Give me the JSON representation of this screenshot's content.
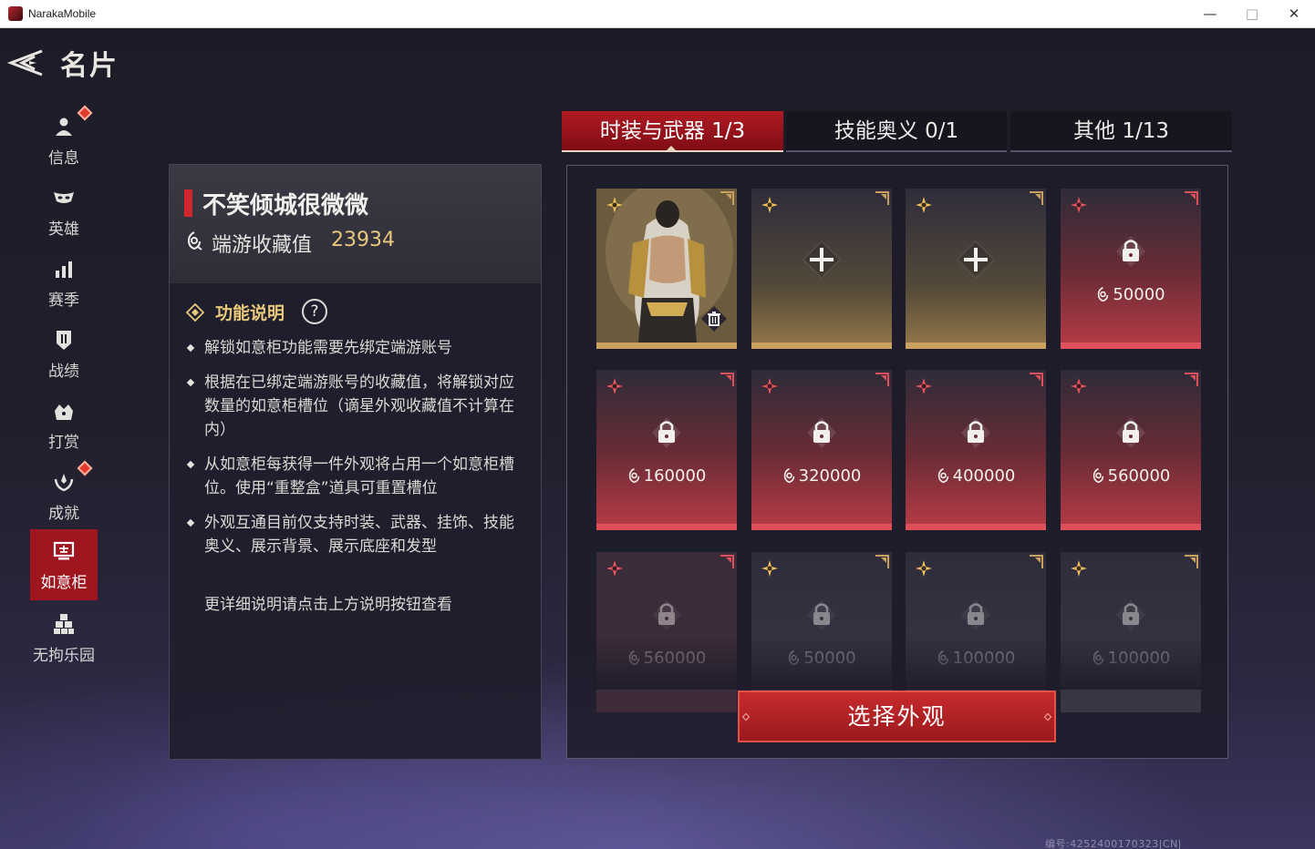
{
  "window": {
    "title": "NarakaMobile",
    "minimize": "—",
    "maximize": "□",
    "close": "✕"
  },
  "page": {
    "title": "名片"
  },
  "sidebar": {
    "items": [
      {
        "label": "信息",
        "icon": "person-icon",
        "badge": true
      },
      {
        "label": "英雄",
        "icon": "mask-icon",
        "badge": false
      },
      {
        "label": "赛季",
        "icon": "bar-chart-icon",
        "badge": false
      },
      {
        "label": "战绩",
        "icon": "shield-icon",
        "badge": false
      },
      {
        "label": "打赏",
        "icon": "gift-icon",
        "badge": false
      },
      {
        "label": "成就",
        "icon": "laurel-icon",
        "badge": true
      },
      {
        "label": "如意柜",
        "icon": "cabinet-icon",
        "badge": false,
        "active": true
      },
      {
        "label": "无拘乐园",
        "icon": "blocks-icon",
        "badge": false
      }
    ]
  },
  "profile": {
    "name": "不笑倾城很微微",
    "collection_label": "端游收藏值",
    "collection_value": "23934"
  },
  "info": {
    "title": "功能说明",
    "help": "?",
    "bullets": [
      "解锁如意柜功能需要先绑定端游账号",
      "根据在已绑定端游账号的收藏值，将解锁对应数量的如意柜槽位（谪星外观收藏值不计算在内）",
      "从如意柜每获得一件外观将占用一个如意柜槽位。使用“重整盒”道具可重置槽位",
      "外观互通目前仅支持时装、武器、挂饰、技能奥义、展示背景、展示底座和发型"
    ],
    "footer": "更详细说明请点击上方说明按钮查看"
  },
  "tabs": [
    {
      "label": "时装与武器  1/3",
      "active": true
    },
    {
      "label": "技能奥义   0/1",
      "active": false
    },
    {
      "label": "其他   1/13",
      "active": false
    }
  ],
  "slots": [
    {
      "type": "filled",
      "rarity": "gold"
    },
    {
      "type": "empty",
      "rarity": "gold"
    },
    {
      "type": "empty",
      "rarity": "gold"
    },
    {
      "type": "locked",
      "rarity": "red",
      "price": "50000"
    },
    {
      "type": "locked",
      "rarity": "red",
      "price": "160000"
    },
    {
      "type": "locked",
      "rarity": "red",
      "price": "320000"
    },
    {
      "type": "locked",
      "rarity": "red",
      "price": "400000"
    },
    {
      "type": "locked",
      "rarity": "red",
      "price": "560000"
    },
    {
      "type": "locked",
      "rarity": "red",
      "price": "560000",
      "dim": true
    },
    {
      "type": "locked",
      "rarity": "gold",
      "price": "50000",
      "dim": true
    },
    {
      "type": "locked",
      "rarity": "gold",
      "price": "100000",
      "dim": true
    },
    {
      "type": "locked",
      "rarity": "gold",
      "price": "100000",
      "dim": true
    }
  ],
  "select_button": "选择外观",
  "footer_id": "编号:4252400170323|CN|",
  "colors": {
    "accent_red": "#a0161f",
    "gold": "#e8c87b",
    "red_slot": "#e0505a",
    "gold_slot": "#c9a05f"
  }
}
